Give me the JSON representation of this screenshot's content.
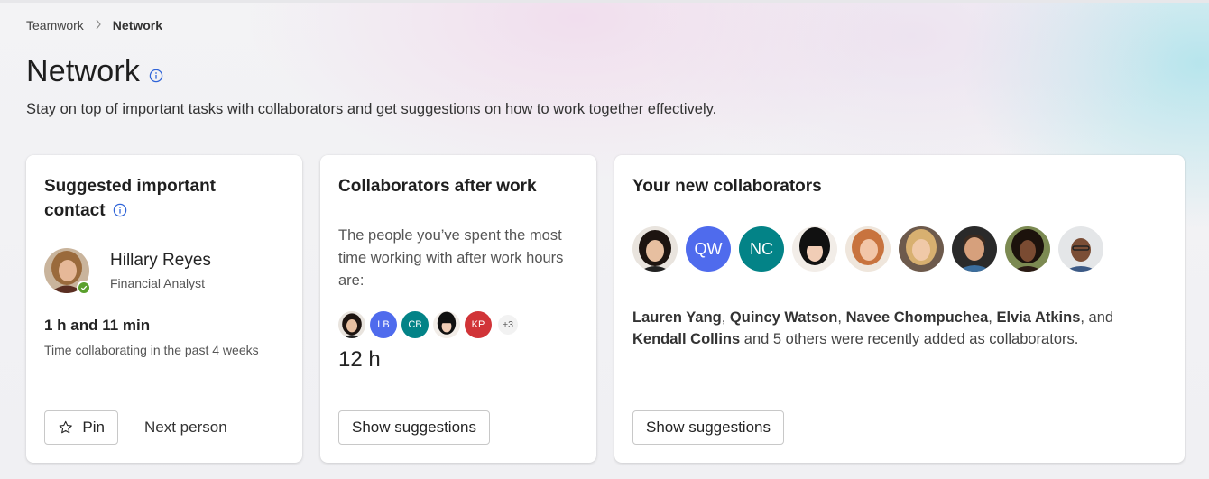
{
  "breadcrumb": {
    "parent": "Teamwork",
    "current": "Network"
  },
  "header": {
    "title": "Network",
    "subtitle": "Stay on top of important tasks with collaborators and get suggestions on how to work together effectively."
  },
  "suggested_contact": {
    "title": "Suggested important contact",
    "name": "Hillary Reyes",
    "role": "Financial Analyst",
    "presence": "available",
    "collab_time": "1 h and 11 min",
    "collab_caption": "Time collaborating in the past 4 weeks",
    "pin_label": "Pin",
    "next_label": "Next person"
  },
  "after_work": {
    "title": "Collaborators after work",
    "description": "The people you’ve spent the most time working with after work hours are:",
    "avatars": [
      {
        "type": "photo",
        "palette": "dark-hair"
      },
      {
        "type": "initials",
        "text": "LB",
        "color": "#4f6bed"
      },
      {
        "type": "initials",
        "text": "CB",
        "color": "#038387"
      },
      {
        "type": "photo",
        "palette": "bangs"
      },
      {
        "type": "initials",
        "text": "KP",
        "color": "#d13438"
      }
    ],
    "more": "+3",
    "hours": "12 h",
    "button_label": "Show suggestions"
  },
  "new_collaborators": {
    "title": "Your new collaborators",
    "avatars": [
      {
        "type": "photo",
        "palette": "dark-hair"
      },
      {
        "type": "initials",
        "text": "QW",
        "color": "#4f6bed"
      },
      {
        "type": "initials",
        "text": "NC",
        "color": "#038387"
      },
      {
        "type": "photo",
        "palette": "bangs"
      },
      {
        "type": "photo",
        "palette": "redhead"
      },
      {
        "type": "photo",
        "palette": "blonde"
      },
      {
        "type": "photo",
        "palette": "man-dark"
      },
      {
        "type": "photo",
        "palette": "curly"
      },
      {
        "type": "photo",
        "palette": "man-glasses"
      }
    ],
    "names": [
      "Lauren Yang",
      "Quincy Watson",
      "Navee Chompuchea",
      "Elvia Atkins",
      "Kendall Collins"
    ],
    "sep_comma": ", ",
    "sep_and": ", and ",
    "tail": " and 5 others were recently added as collaborators.",
    "button_label": "Show suggestions"
  }
}
